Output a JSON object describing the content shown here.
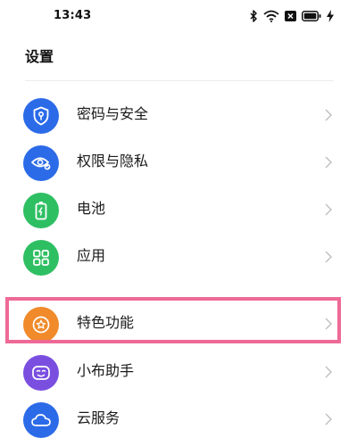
{
  "status_bar": {
    "time": "13:43"
  },
  "page": {
    "title": "设置"
  },
  "items": [
    {
      "label": "密码与安全",
      "icon": "shield-key-icon",
      "color": "#2c6be8"
    },
    {
      "label": "权限与隐私",
      "icon": "eye-privacy-icon",
      "color": "#2c6be8"
    },
    {
      "label": "电池",
      "icon": "battery-icon",
      "color": "#2fbf63"
    },
    {
      "label": "应用",
      "icon": "apps-grid-icon",
      "color": "#2fbf63"
    },
    {
      "label": "特色功能",
      "icon": "star-badge-icon",
      "color": "#f08a2a"
    },
    {
      "label": "小布助手",
      "icon": "assistant-icon",
      "color": "#7a4fe0"
    },
    {
      "label": "云服务",
      "icon": "cloud-icon",
      "color": "#2c6be8"
    }
  ],
  "highlight": {
    "color": "#ee6a96"
  }
}
